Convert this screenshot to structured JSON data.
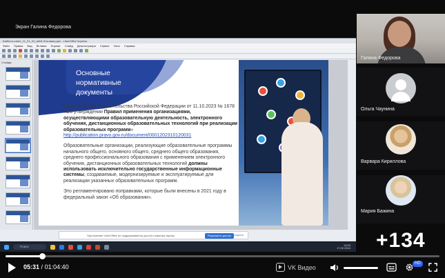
{
  "share": {
    "presenter_label": "Экран Галина Федорова",
    "app": {
      "title": "Шаблон-совет_11_01_24_ШАБ Итоговая.pptx - LibreOffice Impress",
      "menu": [
        "Файл",
        "Правка",
        "Вид",
        "Вставка",
        "Формат",
        "Слайд",
        "Демонстрация",
        "Сервис",
        "Окно",
        "Справка"
      ],
      "slides_panel_label": "Слайды",
      "slide": {
        "heading": "Основные нормативные документы",
        "p1_lead": "Постановление Правительства Российской Федерации от 11.10.2023 № 1678 «Об утверждении ",
        "p1_bold": "Правил применения организациями, осуществляющими образовательную деятельность, электронного обучения, дистанционных образовательных технологий при реализации образовательных программ",
        "p1_tail": "»",
        "p1_link": "http://publication.pravo.gov.ru/document/0001202310120031",
        "p2_lead": "Образовательные организации, реализующие образовательные программы начального общего, основного общего, среднего общего образования, среднего профессионального образования с применением электронного обучения, дистанционных образовательных технологий ",
        "p2_bold": "должны использовать исключительно государственные информационные системы",
        "p2_tail": ", создаваемые, модернизируемые и эксплуатируемые для реализации указанных образовательных программ.",
        "p3": "Это регламентировано поправками, которые были внесены в 2021 году в федеральный закон «Об образовании»."
      },
      "notification": {
        "text": "Приложение LibreOffice не поддерживается доступ к вашему экрану",
        "button": "Разрешить доступ",
        "close": "Скрыть"
      },
      "taskbar": {
        "search_placeholder": "Поиск",
        "time": "13:03",
        "date": "17.02.2024"
      }
    }
  },
  "participants": [
    {
      "name": "Галина Федорова",
      "type": "video"
    },
    {
      "name": "Ольга Чаунина",
      "type": "placeholder"
    },
    {
      "name": "Варвара Кириллова",
      "type": "photo"
    },
    {
      "name": "Мария Бажина",
      "type": "photo"
    }
  ],
  "more_participants": "+134",
  "player": {
    "current_time": "05:31",
    "separator": "/",
    "duration": "01:04:40",
    "progress_fraction": 0.085,
    "volume_fraction": 1.0,
    "brand": "VK Видео",
    "quality_badge": "HD"
  },
  "colors": {
    "accent": "#2a63f5",
    "slide_blue": "#1f3b8f",
    "link": "#1d4ec8"
  }
}
